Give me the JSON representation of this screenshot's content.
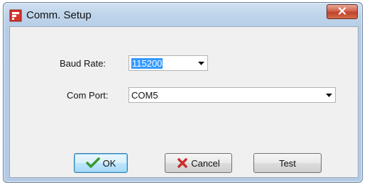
{
  "window": {
    "title": "Comm. Setup"
  },
  "form": {
    "baud_rate": {
      "label": "Baud Rate:",
      "value": "115200"
    },
    "com_port": {
      "label": "Com Port:",
      "value": "COM5"
    }
  },
  "buttons": {
    "ok": {
      "label": "OK",
      "icon": "checkmark-icon"
    },
    "cancel": {
      "label": "Cancel",
      "icon": "x-mark-icon"
    },
    "test": {
      "label": "Test"
    }
  },
  "colors": {
    "ok_check": "#3a9a2f",
    "cancel_x": "#c9302c",
    "selection": "#3399ff",
    "close_button": "#c0432b"
  }
}
